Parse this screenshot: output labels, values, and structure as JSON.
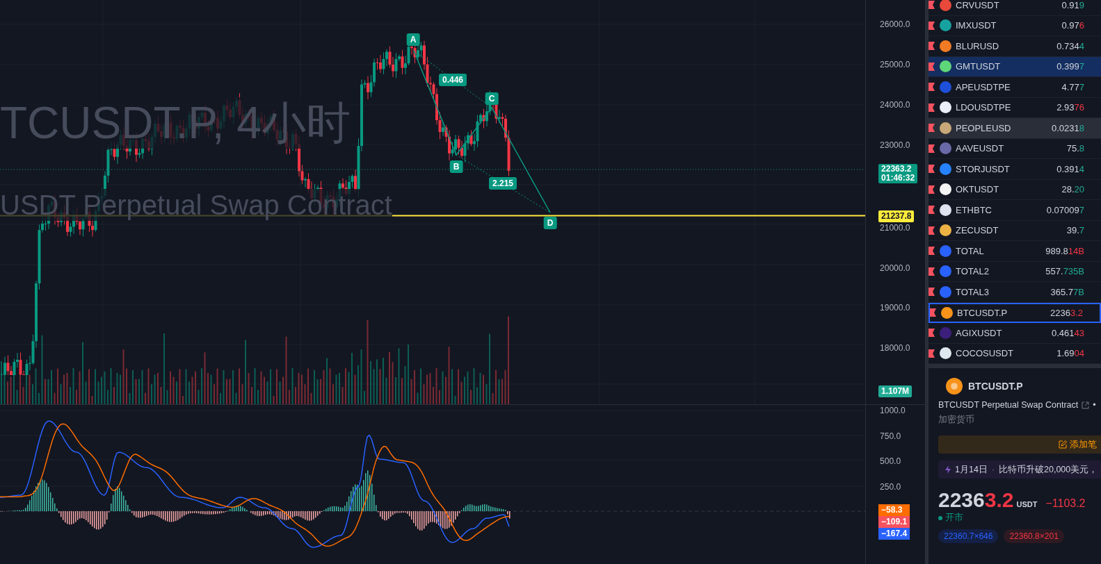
{
  "chart": {
    "watermark": {
      "title": "TCUSDT.P, 4小时",
      "subtitle": "USDT Perpetual Swap Contract"
    },
    "upper_ticks": [
      "26000.0",
      "25000.0",
      "24000.0",
      "23000.0"
    ],
    "lower_ticks": [
      "21000.0",
      "20000.0",
      "19000.0",
      "18000.0"
    ],
    "tags": [
      {
        "kind": "last",
        "label": "22363.2",
        "sub": "01:46:32"
      },
      {
        "kind": "alert",
        "label": "21237.8"
      },
      {
        "kind": "volume",
        "label": "1.107M"
      }
    ],
    "pattern": {
      "points": [
        "A",
        "B",
        "C",
        "D"
      ],
      "ratios": [
        "0.446",
        "2.215"
      ]
    }
  },
  "indicator": {
    "ticks": [
      "1000.0",
      "750.0",
      "500.0",
      "250.0"
    ],
    "tags": [
      {
        "label": "−58.3",
        "color": "#ff6d00"
      },
      {
        "label": "−109.1",
        "color": "#f7525f"
      },
      {
        "label": "−167.4",
        "color": "#2962ff"
      }
    ]
  },
  "watchlist": [
    {
      "symbol": "CRVUSDT",
      "icon": {
        "color": "#e8493a"
      },
      "price": "0.91",
      "tail": {
        "text": "9",
        "color": "#22ab94"
      },
      "selected": false,
      "hovered": false,
      "current": false
    },
    {
      "symbol": "IMXUSDT",
      "icon": {
        "color": "#17a2a0"
      },
      "price": "0.97",
      "tail": {
        "text": "6",
        "color": "#f23645"
      },
      "selected": false,
      "hovered": false,
      "current": false
    },
    {
      "symbol": "BLURUSD",
      "icon": {
        "color": "#f07b24"
      },
      "price": "0.734",
      "tail": {
        "text": "4",
        "color": "#22ab94"
      },
      "selected": false,
      "hovered": false,
      "current": false
    },
    {
      "symbol": "GMTUSDT",
      "icon": {
        "color": "#5ed67a"
      },
      "price": "0.399",
      "tail": {
        "text": "7",
        "color": "#22ab94"
      },
      "selected": true,
      "hovered": false,
      "current": false
    },
    {
      "symbol": "APEUSDTPE",
      "icon": {
        "color": "#1d4fd8"
      },
      "price": "4.77",
      "tail": {
        "text": "7",
        "color": "#22ab94"
      },
      "selected": false,
      "hovered": false,
      "current": false
    },
    {
      "symbol": "LDOUSDTPE",
      "icon": {
        "color": "#e9eef8"
      },
      "price": "2.93",
      "tail": {
        "text": "76",
        "color": "#f23645"
      },
      "selected": false,
      "hovered": false,
      "current": false
    },
    {
      "symbol": "PEOPLEUSD",
      "icon": {
        "color": "#c8a878"
      },
      "price": "0.0231",
      "tail": {
        "text": "8",
        "color": "#22ab94"
      },
      "selected": false,
      "hovered": true,
      "current": false
    },
    {
      "symbol": "AAVEUSDT",
      "icon": {
        "color": "#6a6aa8"
      },
      "price": "75.",
      "tail": {
        "text": "8",
        "color": "#22ab94"
      },
      "selected": false,
      "hovered": false,
      "current": false
    },
    {
      "symbol": "STORJUSDT",
      "icon": {
        "color": "#2683ff"
      },
      "price": "0.391",
      "tail": {
        "text": "4",
        "color": "#22ab94"
      },
      "selected": false,
      "hovered": false,
      "current": false
    },
    {
      "symbol": "OKTUSDT",
      "icon": {
        "color": "#f4f4f4"
      },
      "price": "28.",
      "tail": {
        "text": "20",
        "color": "#22ab94"
      },
      "selected": false,
      "hovered": false,
      "current": false
    },
    {
      "symbol": "ETHBTC",
      "icon": {
        "color": "#dfe3f0"
      },
      "price": "0.07009",
      "tail": {
        "text": "7",
        "color": "#22ab94"
      },
      "selected": false,
      "hovered": false,
      "current": false
    },
    {
      "symbol": "ZECUSDT",
      "icon": {
        "color": "#ecb244"
      },
      "price": "39.",
      "tail": {
        "text": "7",
        "color": "#22ab94"
      },
      "selected": false,
      "hovered": false,
      "current": false
    },
    {
      "symbol": "TOTAL",
      "icon": {
        "color": "#2962ff"
      },
      "price": "989.8",
      "tail": {
        "text": "14B",
        "color": "#f23645"
      },
      "selected": false,
      "hovered": false,
      "current": false
    },
    {
      "symbol": "TOTAL2",
      "icon": {
        "color": "#2962ff"
      },
      "price": "557.",
      "tail": {
        "text": "735B",
        "color": "#22ab94"
      },
      "selected": false,
      "hovered": false,
      "current": false
    },
    {
      "symbol": "TOTAL3",
      "icon": {
        "color": "#2962ff"
      },
      "price": "365.7",
      "tail": {
        "text": "7B",
        "color": "#22ab94"
      },
      "selected": false,
      "hovered": false,
      "current": false
    },
    {
      "symbol": "BTCUSDT.P",
      "icon": {
        "color": "#f7931a"
      },
      "price": "2236",
      "tail": {
        "text": "3.2",
        "color": "#f23645"
      },
      "selected": false,
      "hovered": false,
      "current": true
    },
    {
      "symbol": "AGIXUSDT",
      "icon": {
        "color": "#3b1f7a"
      },
      "price": "0.461",
      "tail": {
        "text": "43",
        "color": "#f23645"
      },
      "selected": false,
      "hovered": false,
      "current": false
    },
    {
      "symbol": "COCOSUSDT",
      "icon": {
        "color": "#dfe8ee"
      },
      "price": "1.69",
      "tail": {
        "text": "04",
        "color": "#f23645"
      },
      "selected": false,
      "hovered": false,
      "current": false
    }
  ],
  "details": {
    "symbol": "BTCUSDT.P",
    "description": "BTCUSDT Perpetual Swap Contract",
    "separator": "•",
    "category": "加密货币",
    "note_button": "添加笔",
    "news": {
      "date": "1月14日",
      "separator": "·",
      "headline": "比特币升破20,000美元，"
    },
    "price": {
      "main": "2236",
      "tail": "3.2",
      "currency": "USDT",
      "change": "−1103.2"
    },
    "market_status": "开市",
    "bid": "22360.7×646",
    "ask": "22360.8×201"
  }
}
